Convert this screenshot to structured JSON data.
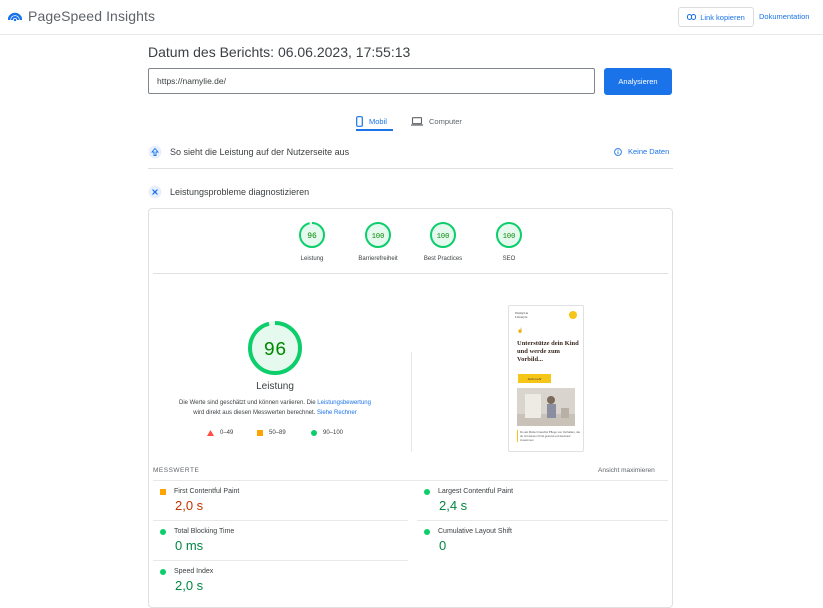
{
  "header": {
    "app_title": "PageSpeed Insights",
    "copy_link": "Link kopieren",
    "docs": "Dokumentation"
  },
  "report": {
    "date_label": "Datum des Berichts: 06.06.2023, 17:55:13",
    "url_value": "https://namylie.de/",
    "analyze_button": "Analysieren"
  },
  "tabs": [
    {
      "label": "Mobil",
      "active": true,
      "icon": "smartphone-icon"
    },
    {
      "label": "Computer",
      "active": false,
      "icon": "laptop-icon"
    }
  ],
  "field_section": {
    "title": "So sieht die Leistung auf der Nutzerseite aus",
    "no_data": "Keine Daten"
  },
  "diagnose_section": {
    "title": "Leistungsprobleme diagnostizieren"
  },
  "scores": [
    {
      "label": "Leistung",
      "value": "96",
      "color": "#0cce6b"
    },
    {
      "label": "Barrierefreiheit",
      "value": "100",
      "color": "#0cce6b"
    },
    {
      "label": "Best Practices",
      "value": "100",
      "color": "#0cce6b"
    },
    {
      "label": "SEO",
      "value": "100",
      "color": "#0cce6b"
    }
  ],
  "performance": {
    "score": "96",
    "label": "Leistung",
    "note_part1": "Die Werte sind geschätzt und können variieren. Die ",
    "note_link1": "Leistungsbewertung",
    "note_part2": "wird direkt aus diesen Messwerten berechnet. ",
    "note_link2": "Siehe Rechner",
    "legend": [
      {
        "range": "0–49",
        "color": "#ff4e42",
        "shape": "triangle"
      },
      {
        "range": "50–89",
        "color": "#ffa400",
        "shape": "square"
      },
      {
        "range": "90–100",
        "color": "#0cce6b",
        "shape": "circle"
      }
    ]
  },
  "screenshot_preview": {
    "headline": "Unterstütze dein Kind und werde zum Vorbild...",
    "cta": "Jetzt mehr",
    "body_text": "Du als Mutter brauchst Pflege von Verhalten, die du mit deinem Kind gesund und bewusst zusammen"
  },
  "metrics": {
    "title": "MESSWERTE",
    "expand": "Ansicht maximieren",
    "items": [
      {
        "name": "First Contentful Paint",
        "value": "2,0 s",
        "status": "average",
        "color": "#c33300",
        "marker": "#ffa400"
      },
      {
        "name": "Largest Contentful Paint",
        "value": "2,4 s",
        "status": "good",
        "color": "#018642",
        "marker": "#0cce6b"
      },
      {
        "name": "Total Blocking Time",
        "value": "0 ms",
        "status": "good",
        "color": "#018642",
        "marker": "#0cce6b"
      },
      {
        "name": "Cumulative Layout Shift",
        "value": "0",
        "status": "good",
        "color": "#018642",
        "marker": "#0cce6b"
      },
      {
        "name": "Speed Index",
        "value": "2,0 s",
        "status": "good",
        "color": "#018642",
        "marker": "#0cce6b"
      }
    ]
  }
}
